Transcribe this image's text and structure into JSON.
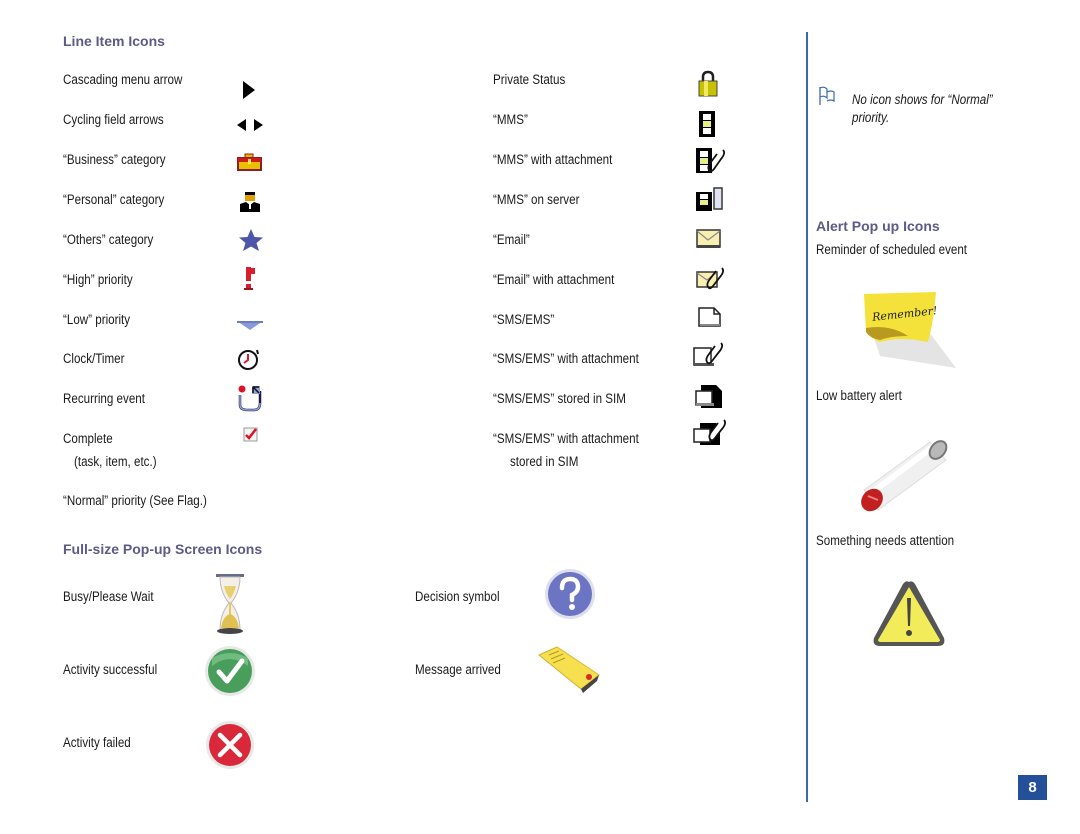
{
  "page_number": "8",
  "colors": {
    "heading": "#5c5a86",
    "divider": "#3b6aa8",
    "page_box": "#24509a"
  },
  "line_item_icons": {
    "heading": "Line Item Icons",
    "left_column": [
      {
        "label": "Cascading menu arrow",
        "icon": "cascading-arrow-icon"
      },
      {
        "label": "Cycling field arrows",
        "icon": "cycling-arrows-icon"
      },
      {
        "label": "“Business” category",
        "icon": "briefcase-icon"
      },
      {
        "label": "“Personal” category",
        "icon": "person-icon"
      },
      {
        "label": "“Others” category",
        "icon": "star-icon"
      },
      {
        "label": "“High” priority",
        "icon": "high-priority-icon"
      },
      {
        "label": "“Low” priority",
        "icon": "low-priority-icon"
      },
      {
        "label": "Clock/Timer",
        "icon": "clock-icon"
      },
      {
        "label": "Recurring event",
        "icon": "recurring-icon"
      },
      {
        "label": "Complete",
        "sublabel": "(task, item, etc.)",
        "icon": "checkbox-icon"
      },
      {
        "label": "“Normal” priority (See Flag.)"
      }
    ],
    "right_column": [
      {
        "label": "Private Status",
        "icon": "lock-icon"
      },
      {
        "label": "“MMS”",
        "icon": "mms-icon"
      },
      {
        "label": "“MMS” with attachment",
        "icon": "mms-attachment-icon"
      },
      {
        "label": "“MMS” on server",
        "icon": "mms-server-icon"
      },
      {
        "label": "“Email”",
        "icon": "email-icon"
      },
      {
        "label": "“Email” with attachment",
        "icon": "email-attachment-icon"
      },
      {
        "label": "“SMS/EMS”",
        "icon": "sms-icon"
      },
      {
        "label": "“SMS/EMS” with attachment",
        "icon": "sms-attachment-icon"
      },
      {
        "label": "“SMS/EMS” stored in SIM",
        "icon": "sms-sim-icon"
      },
      {
        "label": "“SMS/EMS” with attachment",
        "sublabel": "stored in SIM",
        "icon": "sms-attachment-sim-icon"
      }
    ]
  },
  "note": {
    "icon": "flag-icon",
    "text_line1": "No icon shows for “Normal”",
    "text_line2": "priority."
  },
  "fullsize_icons": {
    "heading": "Full-size Pop-up Screen Icons",
    "items": [
      {
        "label": "Busy/Please Wait",
        "icon": "hourglass-icon"
      },
      {
        "label": "Activity successful",
        "icon": "success-check-icon"
      },
      {
        "label": "Activity failed",
        "icon": "failed-x-icon"
      },
      {
        "label": "Decision symbol",
        "icon": "question-icon"
      },
      {
        "label": "Message arrived",
        "icon": "message-envelope-icon"
      }
    ]
  },
  "alert_icons": {
    "heading": "Alert Pop up Icons",
    "items": [
      {
        "label": "Reminder of scheduled event",
        "icon": "sticky-note-icon",
        "note_text": "Remember!"
      },
      {
        "label": "Low battery alert",
        "icon": "battery-icon"
      },
      {
        "label": "Something needs attention",
        "icon": "warning-icon"
      }
    ]
  }
}
